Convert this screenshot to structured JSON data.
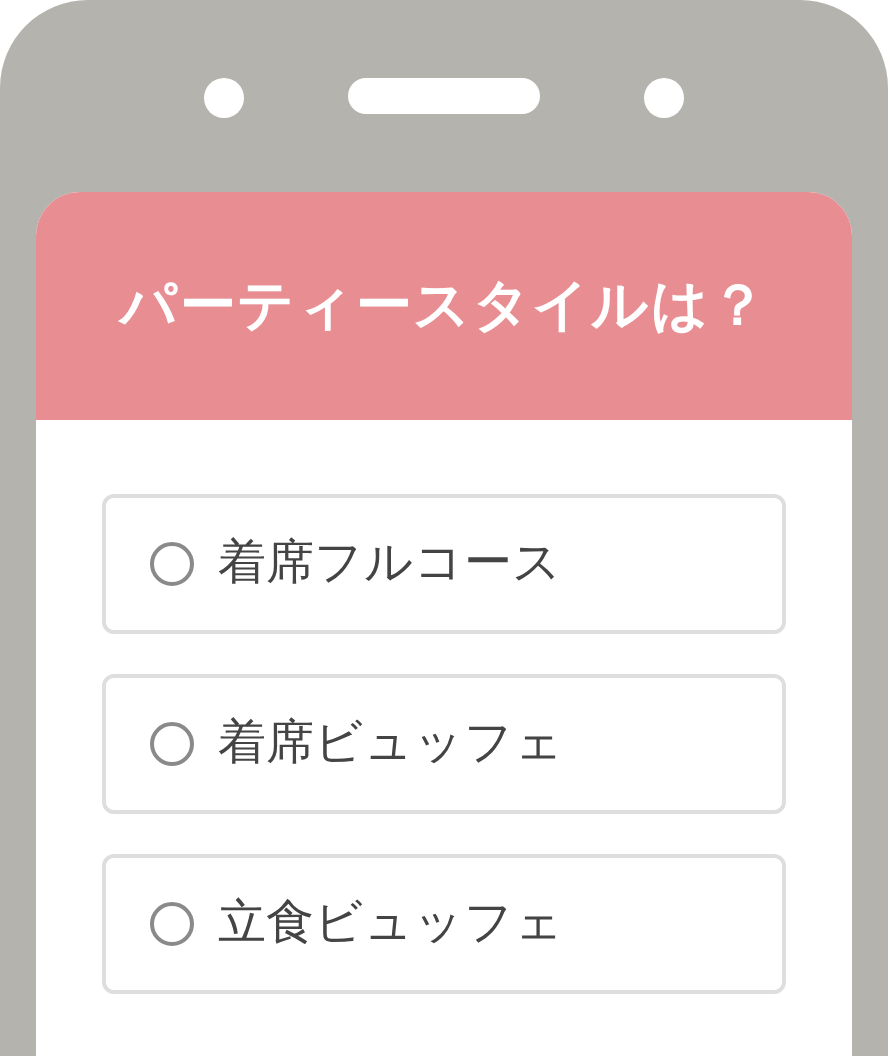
{
  "question": {
    "title": "パーティースタイルは？"
  },
  "options": [
    {
      "label": "着席フルコース",
      "selected": false
    },
    {
      "label": "着席ビュッフェ",
      "selected": false
    },
    {
      "label": "立食ビュッフェ",
      "selected": false
    }
  ]
}
